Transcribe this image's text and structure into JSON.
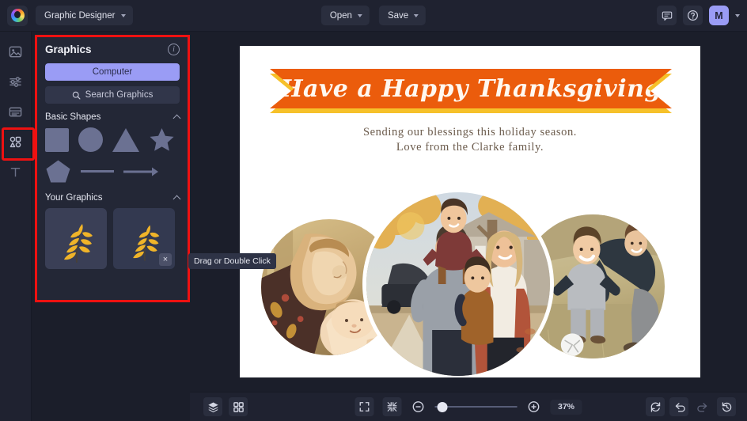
{
  "app": {
    "logo": "bloom-logo-icon",
    "document_name": "Graphic Designer"
  },
  "topbar": {
    "open_label": "Open",
    "save_label": "Save",
    "comment_icon": "comment-icon",
    "help_icon": "help-icon",
    "avatar_initial": "M"
  },
  "rail": {
    "items": [
      {
        "name": "image-icon",
        "label": "Image"
      },
      {
        "name": "adjustments-icon",
        "label": "Adjust"
      },
      {
        "name": "layers-panel-icon",
        "label": "Frames"
      },
      {
        "name": "shapes-icon",
        "label": "Graphics",
        "selected": true
      },
      {
        "name": "text-icon",
        "label": "Text"
      }
    ]
  },
  "panel": {
    "title": "Graphics",
    "info_icon": "info-icon",
    "computer_button": "Computer",
    "search_placeholder": "Search Graphics",
    "search_icon": "search-icon",
    "sections": [
      {
        "title": "Basic Shapes",
        "chevron": "chevron-up-icon",
        "shapes": [
          "square",
          "circle",
          "triangle",
          "star",
          "pentagon",
          "line",
          "arrow"
        ]
      },
      {
        "title": "Your Graphics",
        "chevron": "chevron-up-icon",
        "items": [
          {
            "name": "wheat-graphic-1",
            "close": false
          },
          {
            "name": "wheat-graphic-2",
            "close": true,
            "close_label": "×"
          }
        ]
      }
    ],
    "tooltip": "Drag or Double Click",
    "highlight_color": "#ee1111",
    "accent_color": "#9a9cf5"
  },
  "canvas": {
    "banner_text": "Have a Happy Thanksgiving",
    "banner_color": "#eb5c0c",
    "banner_accent_color": "#f6c12a",
    "greeting_line_1": "Sending our blessings this holiday season.",
    "greeting_line_2": "Love from the Clarke family.",
    "greeting_color": "#6b5b4c",
    "photos": [
      {
        "name": "photo-mother-and-baby"
      },
      {
        "name": "photo-family-portrait"
      },
      {
        "name": "photo-father-and-child"
      }
    ]
  },
  "bottombar": {
    "layers_icon": "layers-icon",
    "grid_icon": "grid-icon",
    "fit_screen_icon": "fit-screen-icon",
    "shrink_icon": "shrink-to-fit-icon",
    "zoom_out_icon": "zoom-out-icon",
    "zoom_in_icon": "zoom-in-icon",
    "zoom_level": "37%",
    "zoom_slider_percent": 3,
    "reset_icon": "reset-icon",
    "undo_icon": "undo-icon",
    "redo_icon": "redo-icon",
    "history_icon": "history-icon"
  }
}
